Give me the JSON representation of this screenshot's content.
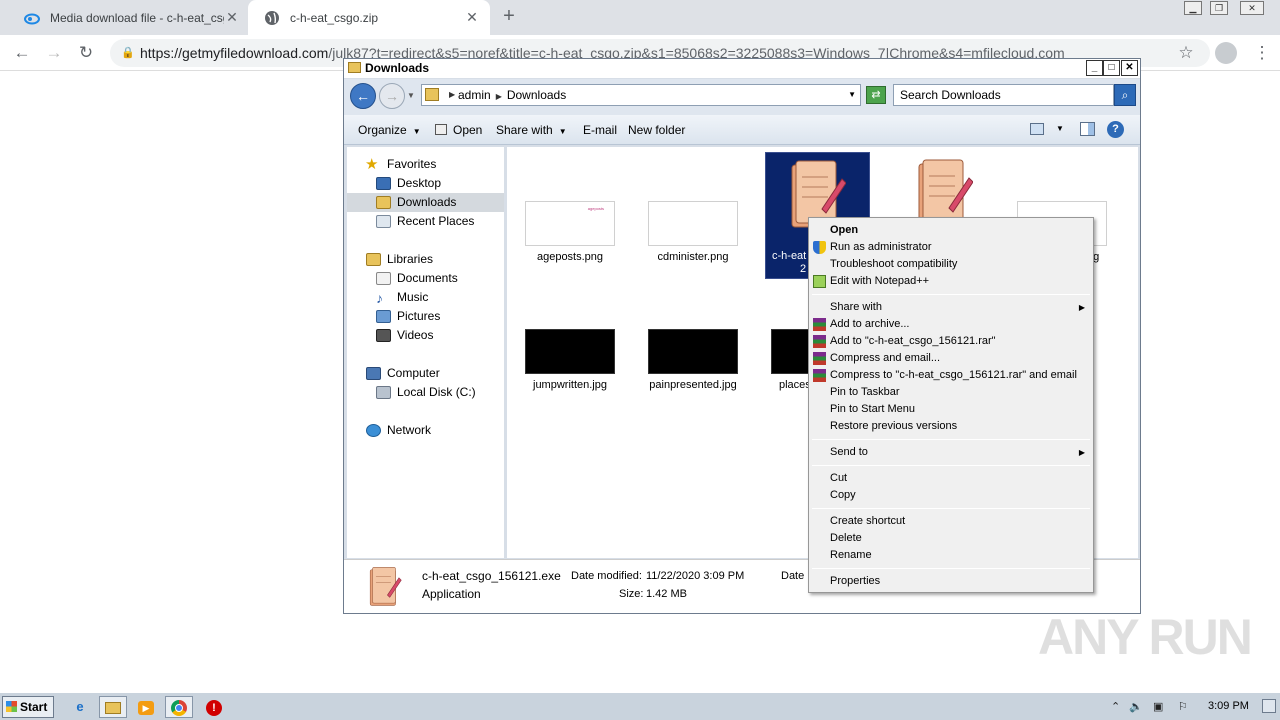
{
  "browser": {
    "tabs": [
      {
        "label": "Media download file - c-h-eat_csgo.zi",
        "active": false
      },
      {
        "label": "c-h-eat_csgo.zip",
        "active": true
      }
    ],
    "url_main": "https://getmyfiledownload.com",
    "url_rest": "/julk87?t=redirect&s5=noref&title=c-h-eat_csgo.zip&s1=85068s2=3225088s3=Windows_7|Chrome&s4=mfilecloud.com"
  },
  "explorer": {
    "title": "Downloads",
    "breadcrumb": [
      "admin",
      "Downloads"
    ],
    "search_placeholder": "Search Downloads",
    "commands": {
      "organize": "Organize",
      "open": "Open",
      "share_with": "Share with",
      "email": "E-mail",
      "new_folder": "New folder"
    },
    "nav": {
      "favorites": "Favorites",
      "desktop": "Desktop",
      "downloads": "Downloads",
      "recent": "Recent Places",
      "libraries": "Libraries",
      "documents": "Documents",
      "music": "Music",
      "pictures": "Pictures",
      "videos": "Videos",
      "computer": "Computer",
      "local_disk": "Local Disk (C:)",
      "network": "Network"
    },
    "files": {
      "f1": "ageposts.png",
      "f1_thumb_text": "ageposts",
      "f2": "cdminister.png",
      "f3": "c-h-eat",
      "f3b": "2",
      "f4": "ng",
      "f5": "jumpwritten.jpg",
      "f6": "painpresented.jpg",
      "f7": "places"
    },
    "details": {
      "name": "c-h-eat_csgo_156121.exe",
      "type": "Application",
      "date_modified_label": "Date modified:",
      "date_modified": "11/22/2020 3:09 PM",
      "size_label": "Size:",
      "size": "1.42 MB",
      "date_created_label": "Date"
    }
  },
  "context_menu": {
    "open": "Open",
    "run_admin": "Run as administrator",
    "troubleshoot": "Troubleshoot compatibility",
    "edit_notepad": "Edit with Notepad++",
    "share_with": "Share with",
    "add_archive": "Add to archive...",
    "add_to_rar": "Add to \"c-h-eat_csgo_156121.rar\"",
    "compress_email": "Compress and email...",
    "compress_rar_email": "Compress to \"c-h-eat_csgo_156121.rar\" and email",
    "pin_taskbar": "Pin to Taskbar",
    "pin_start": "Pin to Start Menu",
    "restore": "Restore previous versions",
    "send_to": "Send to",
    "cut": "Cut",
    "copy": "Copy",
    "create_shortcut": "Create shortcut",
    "delete": "Delete",
    "rename": "Rename",
    "properties": "Properties"
  },
  "taskbar": {
    "start": "Start",
    "clock": "3:09 PM"
  },
  "watermark": "ANY RUN"
}
